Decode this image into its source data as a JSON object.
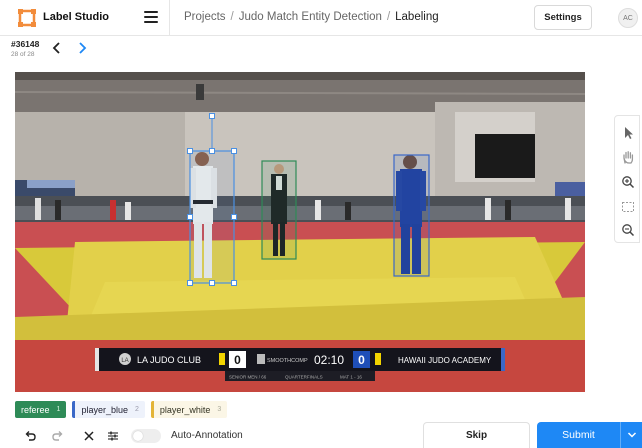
{
  "header": {
    "app_title": "Label Studio",
    "breadcrumb": [
      "Projects",
      "Judo Match Entity Detection",
      "Labeling"
    ],
    "settings_label": "Settings",
    "avatar_initials": "AC"
  },
  "task": {
    "id": "#36148",
    "position": "28 of 28"
  },
  "scoreboard": {
    "left_team": "LA JUDO CLUB",
    "left_score": "0",
    "sponsor": "SMOOTHCOMP",
    "clock": "02:10",
    "right_score": "0",
    "right_team": "HAWAII JUDO ACADEMY",
    "subline_1": "SENIOR MEN / 66",
    "subline_2": "QUARTERFINALS",
    "subline_3": "MAT 1 - 16"
  },
  "labels": [
    {
      "name": "referee",
      "hotkey": "1",
      "color": "#2e8b57"
    },
    {
      "name": "player_blue",
      "hotkey": "2",
      "color": "#3a68c8"
    },
    {
      "name": "player_white",
      "hotkey": "3",
      "color": "#e3b437"
    }
  ],
  "toolbar_icons": [
    "pointer-icon",
    "pan-hand-icon",
    "zoom-in-icon",
    "fit-screen-icon",
    "zoom-out-icon"
  ],
  "bottom": {
    "auto_annotation_label": "Auto-Annotation",
    "auto_annotation_enabled": false,
    "skip_label": "Skip",
    "submit_label": "Submit"
  },
  "colors": {
    "primary": "#1e88f5",
    "referee": "#2e8b57",
    "player_blue": "#3a68c8",
    "player_white": "#e3b437",
    "selection": "#4a90e2"
  }
}
